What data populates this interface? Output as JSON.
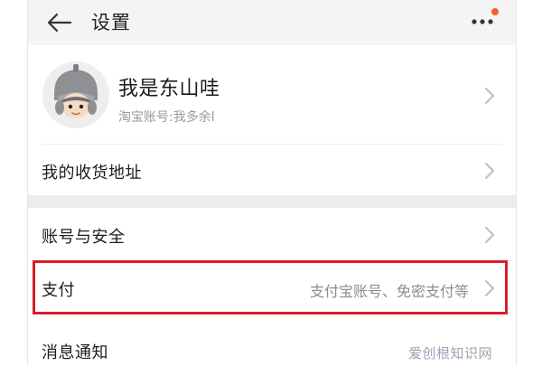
{
  "header": {
    "title": "设置"
  },
  "profile": {
    "name": "我是东山哇",
    "account": "淘宝账号:我多余l"
  },
  "rows": [
    {
      "label": "我的收货地址",
      "sub": ""
    },
    {
      "label": "账号与安全",
      "sub": ""
    },
    {
      "label": "支付",
      "sub": "支付宝账号、免密支付等"
    },
    {
      "label": "消息通知",
      "sub": ""
    }
  ],
  "watermark": "爱创根知识网",
  "colors": {
    "highlight": "#d81e2a",
    "notification_dot": "#f06424"
  },
  "icons": {
    "back": "back-arrow-icon",
    "more": "more-dots-icon",
    "chevron": "chevron-right-icon",
    "avatar": "avatar-helmet-boy"
  }
}
